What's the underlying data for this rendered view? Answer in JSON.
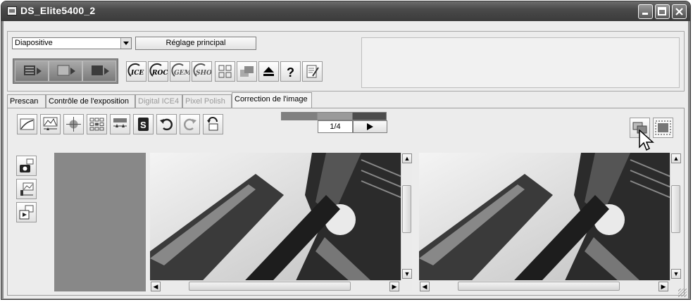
{
  "window": {
    "title": "DS_Elite5400_2",
    "controls": {
      "minimize": "minimize-icon",
      "maximize": "maximize-icon",
      "close": "close-icon"
    }
  },
  "top_panel": {
    "film_type": {
      "selected": "Diapositive"
    },
    "main_setting_label": "Réglage principal",
    "mode_buttons": [
      "index-scan-icon",
      "prescan-icon",
      "scan-icon"
    ],
    "toolbar_icons": [
      "ice-icon",
      "roc-icon",
      "gem-icon",
      "sho-icon",
      "grid-view-icon",
      "stack-icon",
      "eject-icon",
      "help-icon",
      "preferences-icon"
    ],
    "badges": {
      "ice": "ICE",
      "roc": "ROC",
      "gem": "GEM",
      "sho": "SHO",
      "help": "?"
    }
  },
  "tabs": [
    {
      "label": "Prescan",
      "enabled": true,
      "active": false
    },
    {
      "label": "Contrôle de l'exposition",
      "enabled": true,
      "active": false
    },
    {
      "label": "Digital ICE4",
      "enabled": false,
      "active": false
    },
    {
      "label": "Pixel Polish",
      "enabled": false,
      "active": false
    },
    {
      "label": "Correction de l'image",
      "enabled": true,
      "active": true
    }
  ],
  "correction_toolbar": [
    "curves-icon",
    "histogram-icon",
    "color-balance-icon",
    "variations-icon",
    "levels-icon",
    "selective-color-icon",
    "undo-icon",
    "redo-icon",
    "reset-icon"
  ],
  "frame_nav": {
    "indicator": "1/4",
    "position": 0.25
  },
  "view_buttons": [
    "side-by-side-view-icon",
    "full-view-icon"
  ],
  "side_buttons": [
    "camera-icon",
    "tone-icon",
    "preview-icon"
  ],
  "scroll_glyphs": {
    "up": "▲",
    "down": "▼",
    "left": "◀",
    "right": "▶"
  }
}
